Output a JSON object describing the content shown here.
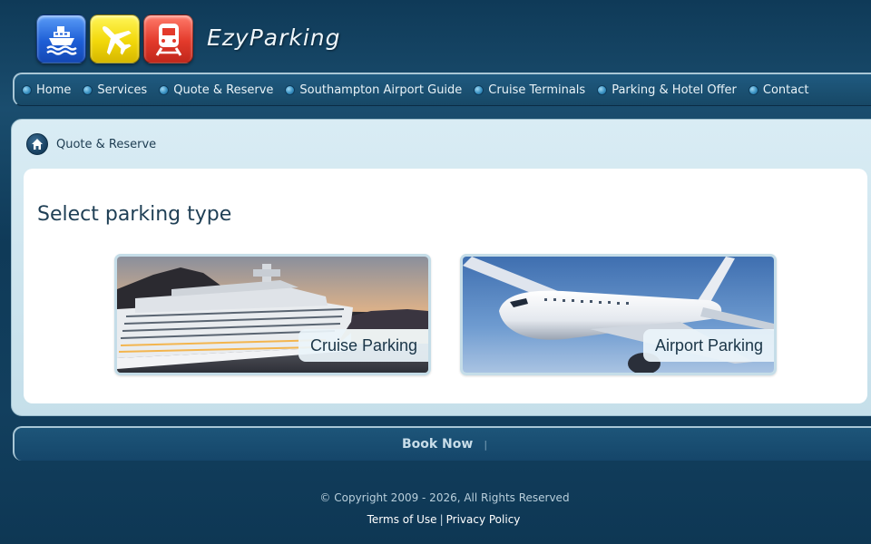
{
  "header": {
    "brand": "EzyParking",
    "icons": [
      "ship-icon",
      "airplane-icon",
      "train-icon"
    ]
  },
  "nav": {
    "items": [
      {
        "label": "Home"
      },
      {
        "label": "Services"
      },
      {
        "label": "Quote & Reserve"
      },
      {
        "label": "Southampton Airport Guide"
      },
      {
        "label": "Cruise Terminals"
      },
      {
        "label": "Parking & Hotel Offer"
      },
      {
        "label": "Contact"
      }
    ]
  },
  "breadcrumb": {
    "current": "Quote & Reserve"
  },
  "main": {
    "title": "Select parking type",
    "options": [
      {
        "label": "Cruise Parking",
        "image": "cruise-ship-photo"
      },
      {
        "label": "Airport Parking",
        "image": "airplane-photo"
      }
    ]
  },
  "footer": {
    "book_now": "Book Now",
    "separator": "|",
    "copyright": "© Copyright 2009 - 2026, All Rights Reserved",
    "terms": "Terms of Use",
    "pipe": "|",
    "privacy": "Privacy Policy"
  },
  "colors": {
    "background": "#0f3a58",
    "panel": "#d9ecf4",
    "text_dark": "#1f3f55"
  }
}
